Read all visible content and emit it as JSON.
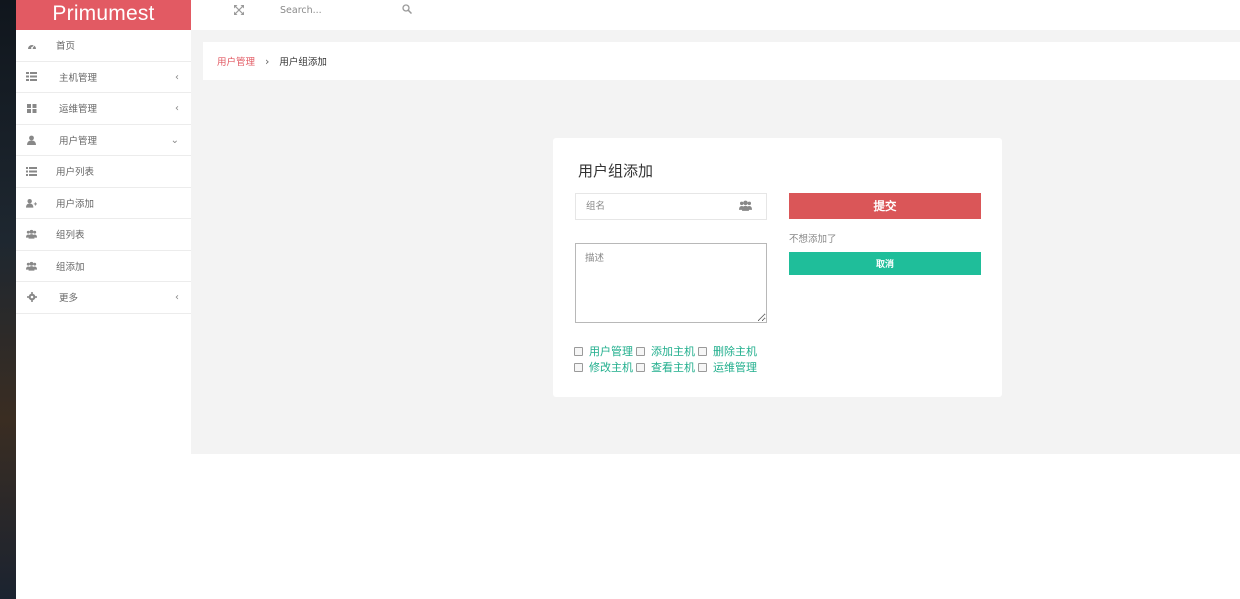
{
  "brand": {
    "title": "Primumest",
    "color": "#e25a63"
  },
  "topbar": {
    "expand_icon": "expand-icon",
    "search": {
      "placeholder": "Search...",
      "icon": "search-icon"
    }
  },
  "sidebar": {
    "items": [
      {
        "label": "首页",
        "icon": "dashboard-icon",
        "chevron": ""
      },
      {
        "label": "主机管理",
        "icon": "server-list-icon",
        "chevron": "‹"
      },
      {
        "label": "运维管理",
        "icon": "grid-icon",
        "chevron": "‹"
      },
      {
        "label": "用户管理",
        "icon": "user-icon",
        "chevron": "⌄"
      },
      {
        "label": "用户列表",
        "icon": "list-icon",
        "chevron": ""
      },
      {
        "label": "用户添加",
        "icon": "user-plus-icon",
        "chevron": ""
      },
      {
        "label": "组列表",
        "icon": "users-icon",
        "chevron": ""
      },
      {
        "label": "组添加",
        "icon": "users-icon",
        "chevron": ""
      },
      {
        "label": "更多",
        "icon": "gear-icon",
        "chevron": "‹"
      }
    ]
  },
  "breadcrumb": {
    "parent": "用户管理",
    "separator": "›",
    "current": "用户组添加"
  },
  "form": {
    "title": "用户组添加",
    "group_name": {
      "value": "",
      "placeholder": "组名",
      "icon": "users-icon"
    },
    "description": {
      "value": "",
      "placeholder": "描述"
    },
    "submit_label": "提交",
    "hint": "不想添加了",
    "cancel_label": "取消",
    "permissions": [
      [
        "用户管理",
        "添加主机",
        "删除主机"
      ],
      [
        "修改主机",
        "查看主机",
        "运维管理"
      ]
    ]
  },
  "colors": {
    "submit": "#da5658",
    "cancel": "#1fbe9a",
    "accent_text": "#1fae8c",
    "background": "#f3f3f3"
  }
}
